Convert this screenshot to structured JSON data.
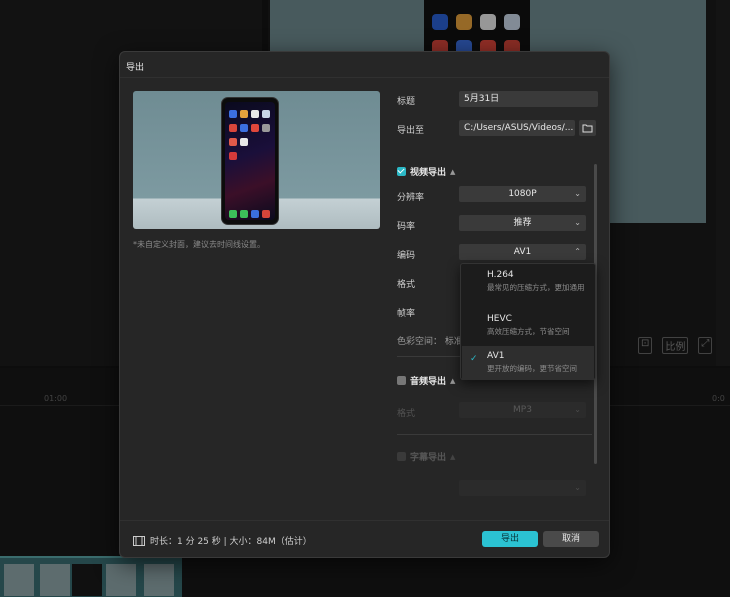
{
  "background": {
    "ruler_ticks": [
      "01:00",
      "0:0"
    ],
    "preview_icons": [
      "fit-icon",
      "ratio-label",
      "fullscreen-icon"
    ],
    "ratio_label": "比例"
  },
  "dialog": {
    "title": "导出",
    "cover_note": "*未自定义封面，建议去时间线设置。",
    "fields": {
      "title_label": "标题",
      "title_value": "5月31日",
      "export_to_label": "导出至",
      "export_to_value": "C:/Users/ASUS/Videos/..."
    },
    "video_section": {
      "label": "视频导出",
      "checked": true,
      "resolution_label": "分辨率",
      "resolution_value": "1080P",
      "bitrate_label": "码率",
      "bitrate_value": "推荐",
      "codec_label": "编码",
      "codec_value": "AV1",
      "format_label": "格式",
      "framerate_label": "帧率",
      "colorspace_label": "色彩空间：",
      "colorspace_value": "标准"
    },
    "codec_dropdown": [
      {
        "name": "H.264",
        "desc": "最常见的压缩方式，更加通用",
        "selected": false
      },
      {
        "name": "HEVC",
        "desc": "高效压缩方式，节省空间",
        "selected": false
      },
      {
        "name": "AV1",
        "desc": "更开放的编码，更节省空间",
        "selected": true
      }
    ],
    "audio_section": {
      "label": "音频导出",
      "checked": false,
      "format_label": "格式",
      "format_value": "MP3"
    },
    "subtitle_section": {
      "label": "字幕导出"
    },
    "footer": {
      "info": "时长：1 分 25 秒 | 大小：84M（估计）",
      "export_button": "导出",
      "cancel_button": "取消"
    }
  },
  "colors": {
    "accent": "#2bc2d2",
    "dialog_bg": "#262626",
    "field_bg": "#3a3a3a"
  }
}
